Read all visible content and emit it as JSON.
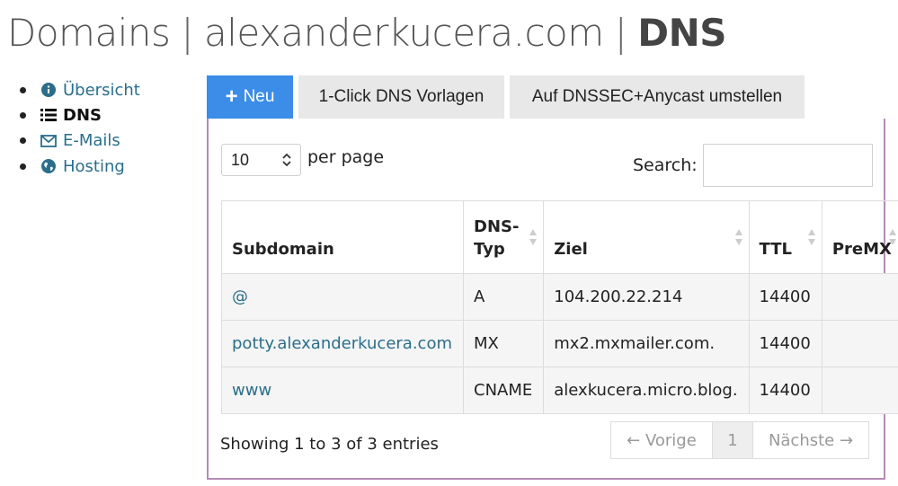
{
  "header": {
    "part1": "Domains",
    "separator": "|",
    "domain": "alexanderkucera.com",
    "current": "DNS"
  },
  "sidebar": {
    "items": [
      {
        "label": "Übersicht",
        "icon": "info-circle-icon"
      },
      {
        "label": "DNS",
        "icon": "list-icon",
        "active": true
      },
      {
        "label": "E-Mails",
        "icon": "envelope-icon"
      },
      {
        "label": "Hosting",
        "icon": "globe-icon"
      }
    ]
  },
  "toolbar": {
    "new_label": "Neu",
    "templates_label": "1-Click DNS Vorlagen",
    "dnssec_label": "Auf DNSSEC+Anycast umstellen"
  },
  "table_controls": {
    "page_length_value": "10",
    "per_page_label": "per page",
    "search_label": "Search:",
    "search_value": ""
  },
  "table": {
    "columns": [
      {
        "label": "Subdomain",
        "sortable": false
      },
      {
        "label": "DNS-Typ",
        "sortable": true
      },
      {
        "label": "Ziel",
        "sortable": true
      },
      {
        "label": "TTL",
        "sortable": true
      },
      {
        "label": "PreMX",
        "sortable": true
      }
    ],
    "rows": [
      {
        "subdomain": "@",
        "type": "A",
        "target": "104.200.22.214",
        "ttl": "14400",
        "premx": ""
      },
      {
        "subdomain": "potty.alexanderkucera.com",
        "type": "MX",
        "target": "mx2.mxmailer.com.",
        "ttl": "14400",
        "premx": ""
      },
      {
        "subdomain": "www",
        "type": "CNAME",
        "target": "alexkucera.micro.blog.",
        "ttl": "14400",
        "premx": ""
      }
    ]
  },
  "footer": {
    "info": "Showing 1 to 3 of 3 entries",
    "prev_label": "← Vorige",
    "page": "1",
    "next_label": "Nächste →"
  },
  "colors": {
    "accent": "#3b8de8",
    "link": "#2a6e8c",
    "panel_border": "#b58ab8"
  }
}
